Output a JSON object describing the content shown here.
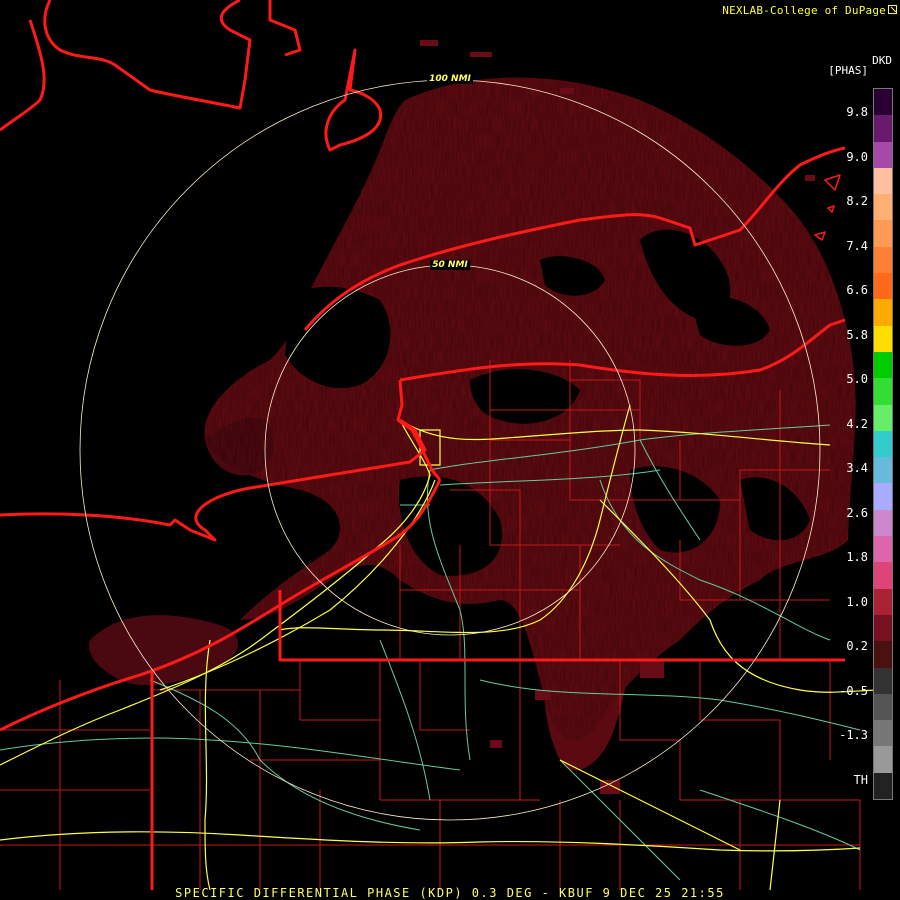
{
  "credit": "NEXLAB-College of DuPage",
  "legend": {
    "product_code": "DKD",
    "unit": "[PHAS]",
    "ticks": [
      "9.8",
      "9.0",
      "8.2",
      "7.4",
      "6.6",
      "5.8",
      "5.0",
      "4.2",
      "3.4",
      "2.6",
      "1.8",
      "1.0",
      "0.2",
      "-0.5",
      "-1.3",
      "TH"
    ],
    "colors": [
      "#2a0033",
      "#6a1a6e",
      "#a54aa8",
      "#ffc0a0",
      "#ffb070",
      "#ff9a55",
      "#ff8035",
      "#ff6a1a",
      "#ffaa00",
      "#ffdd00",
      "#00cc00",
      "#33dd33",
      "#66ee66",
      "#33cccc",
      "#66bbdd",
      "#aaaaff",
      "#cc88cc",
      "#dd66aa",
      "#dd4477",
      "#aa2233",
      "#771122",
      "#4a1111",
      "#333333",
      "#555555",
      "#777777",
      "#999999",
      "#222222"
    ]
  },
  "rings": [
    {
      "label": "100 NMI"
    },
    {
      "label": "50 NMI"
    }
  ],
  "bottom_title": "SPECIFIC DIFFERENTIAL PHASE (KDP) 0.3 DEG - KBUF 9 DEC 25 21:55",
  "colors": {
    "echo": "#5a0a10",
    "echo_dark": "#3c050a",
    "border": "#ff1a1a",
    "county": "#cc1a1a",
    "interstate": "#ffff44",
    "highway": "#66cc99",
    "ring": "#ffeecc"
  }
}
